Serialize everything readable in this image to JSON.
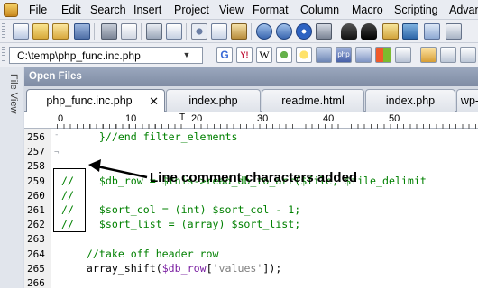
{
  "menu": {
    "items": [
      "File",
      "Edit",
      "Search",
      "Insert",
      "Project",
      "View",
      "Format",
      "Column",
      "Macro",
      "Scripting",
      "Advan"
    ]
  },
  "path": {
    "value": "C:\\temp\\php_func.inc.php"
  },
  "side_panel": {
    "label": "File View"
  },
  "open_files": {
    "title": "Open Files"
  },
  "tabs": [
    {
      "label": "php_func.inc.php",
      "active": true
    },
    {
      "label": "index.php",
      "active": false
    },
    {
      "label": "readme.html",
      "active": false
    },
    {
      "label": "index.php",
      "active": false
    },
    {
      "label": "wp-",
      "active": false
    }
  ],
  "ruler": {
    "labels": [
      "0",
      "10",
      "20",
      "30",
      "40",
      "50"
    ]
  },
  "editor": {
    "lines": [
      {
        "no": "256",
        "segments": [
          {
            "t": "      }//end filter_elements",
            "c": "c-comment"
          }
        ]
      },
      {
        "no": "257",
        "segments": [
          {
            "t": "",
            "c": ""
          }
        ]
      },
      {
        "no": "258",
        "segments": [
          {
            "t": "",
            "c": ""
          }
        ]
      },
      {
        "no": "259",
        "segments": [
          {
            "t": "//",
            "c": "c-comment"
          },
          {
            "t": "    $db_row = $this->read_db_to_arr($file, $file_delimit",
            "c": "c-comment"
          }
        ]
      },
      {
        "no": "260",
        "segments": [
          {
            "t": "//",
            "c": "c-comment"
          }
        ]
      },
      {
        "no": "261",
        "segments": [
          {
            "t": "//",
            "c": "c-comment"
          },
          {
            "t": "    $sort_col = (int) $sort_col - 1;",
            "c": "c-comment"
          }
        ]
      },
      {
        "no": "262",
        "segments": [
          {
            "t": "//",
            "c": "c-comment"
          },
          {
            "t": "    $sort_list = (array) $sort_list;",
            "c": "c-comment"
          }
        ]
      },
      {
        "no": "263",
        "segments": [
          {
            "t": "",
            "c": ""
          }
        ]
      },
      {
        "no": "264",
        "segments": [
          {
            "t": "    //take off header row",
            "c": "c-comment"
          }
        ]
      },
      {
        "no": "265",
        "segments": [
          {
            "t": "    array_shift(",
            "c": ""
          },
          {
            "t": "$db_row",
            "c": "c-var"
          },
          {
            "t": "[",
            "c": ""
          },
          {
            "t": "'values'",
            "c": "c-str"
          },
          {
            "t": "]);",
            "c": ""
          }
        ]
      },
      {
        "no": "266",
        "segments": [
          {
            "t": "",
            "c": ""
          }
        ]
      }
    ]
  },
  "annotation": {
    "text": "Line comment characters added"
  },
  "icons": {
    "toolbar1": [
      "new-file-icon",
      "open-folder-icon",
      "open-icon",
      "save-icon",
      "save-all-icon",
      "close-file-icon",
      "print-icon",
      "print-preview-icon",
      "cut-icon",
      "copy-icon",
      "paste-icon",
      "undo-icon",
      "redo-icon",
      "web-browser-icon",
      "settings-icon",
      "find-icon",
      "replace-icon",
      "find-in-files-icon",
      "replace-in-files-icon"
    ],
    "toolbar2": [
      "google-icon",
      "yahoo-icon",
      "wikipedia-icon",
      "msn-icon",
      "tip-icon",
      "php-manual-icon",
      "mysql-icon",
      "windows-icon",
      "spell-check-icon",
      "format-icon"
    ]
  }
}
